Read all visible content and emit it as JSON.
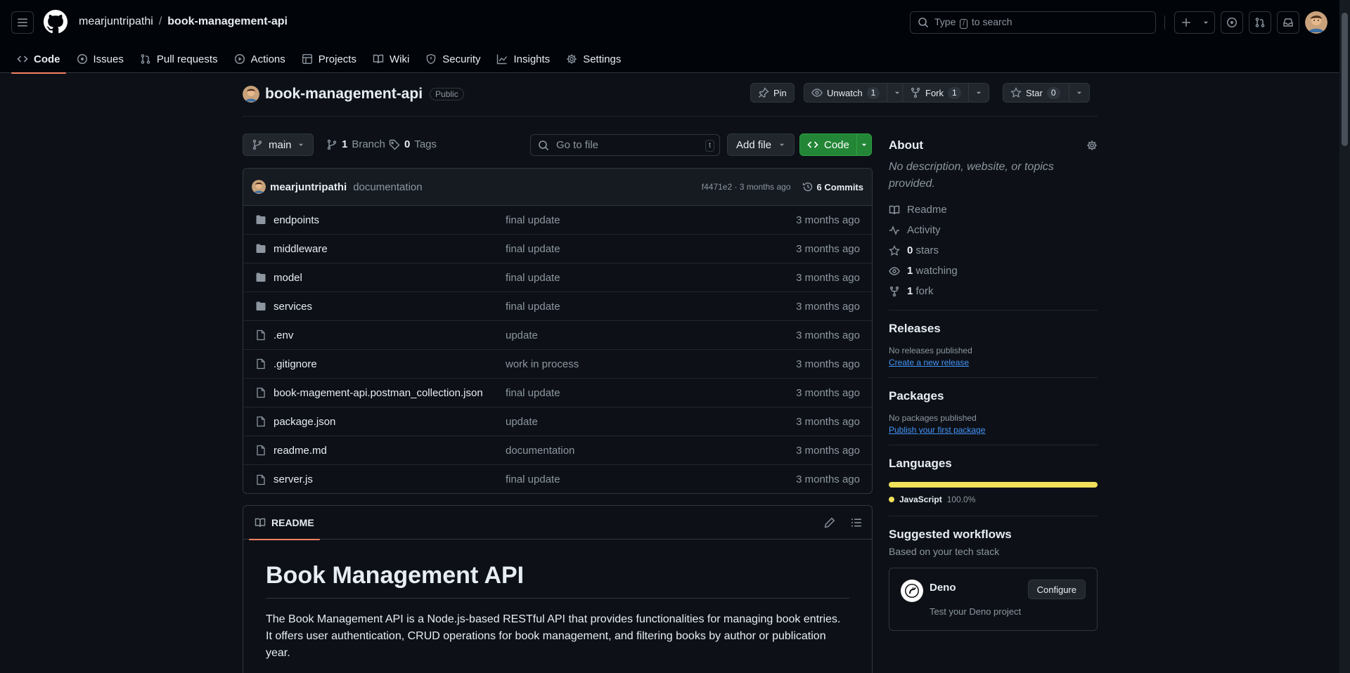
{
  "header": {
    "owner": "mearjuntripathi",
    "separator": "/",
    "repo": "book-management-api",
    "search_prefix": "Type",
    "search_key": "/",
    "search_suffix": "to search"
  },
  "nav": {
    "tabs": [
      {
        "label": "Code",
        "icon": "code-icon"
      },
      {
        "label": "Issues",
        "icon": "issue-icon"
      },
      {
        "label": "Pull requests",
        "icon": "pull-request-icon"
      },
      {
        "label": "Actions",
        "icon": "play-icon"
      },
      {
        "label": "Projects",
        "icon": "table-icon"
      },
      {
        "label": "Wiki",
        "icon": "book-icon"
      },
      {
        "label": "Security",
        "icon": "shield-icon"
      },
      {
        "label": "Insights",
        "icon": "graph-icon"
      },
      {
        "label": "Settings",
        "icon": "gear-icon"
      }
    ]
  },
  "repo": {
    "name": "book-management-api",
    "visibility": "Public",
    "pin_label": "Pin",
    "unwatch_label": "Unwatch",
    "watch_count": "1",
    "fork_label": "Fork",
    "fork_count": "1",
    "star_label": "Star",
    "star_count": "0"
  },
  "filenav": {
    "branch": "main",
    "branch_count": "1",
    "branch_label": "Branch",
    "tag_count": "0",
    "tag_label": "Tags",
    "goto_placeholder": "Go to file",
    "goto_key": "t",
    "add_file": "Add file",
    "code": "Code"
  },
  "commit": {
    "author": "mearjuntripathi",
    "message": "documentation",
    "hash_time": "f4471e2 · 3 months ago",
    "commits": "6 Commits"
  },
  "files": [
    {
      "name": "endpoints",
      "type": "folder",
      "msg": "final update",
      "age": "3 months ago"
    },
    {
      "name": "middleware",
      "type": "folder",
      "msg": "final update",
      "age": "3 months ago"
    },
    {
      "name": "model",
      "type": "folder",
      "msg": "final update",
      "age": "3 months ago"
    },
    {
      "name": "services",
      "type": "folder",
      "msg": "final update",
      "age": "3 months ago"
    },
    {
      "name": ".env",
      "type": "file",
      "msg": "update",
      "age": "3 months ago"
    },
    {
      "name": ".gitignore",
      "type": "file",
      "msg": "work in process",
      "age": "3 months ago"
    },
    {
      "name": "book-magement-api.postman_collection.json",
      "type": "file",
      "msg": "final update",
      "age": "3 months ago"
    },
    {
      "name": "package.json",
      "type": "file",
      "msg": "update",
      "age": "3 months ago"
    },
    {
      "name": "readme.md",
      "type": "file",
      "msg": "documentation",
      "age": "3 months ago"
    },
    {
      "name": "server.js",
      "type": "file",
      "msg": "final update",
      "age": "3 months ago"
    }
  ],
  "readme": {
    "tab": "README",
    "title": "Book Management API",
    "body": "The Book Management API is a Node.js-based RESTful API that provides functionalities for managing book entries. It offers user authentication, CRUD operations for book management, and filtering books by author or publication year."
  },
  "sidebar": {
    "about_title": "About",
    "about_desc": "No description, website, or topics provided.",
    "links": {
      "readme": "Readme",
      "activity": "Activity",
      "stars_count": "0",
      "stars_label": "stars",
      "watching_count": "1",
      "watching_label": "watching",
      "fork_count": "1",
      "fork_label": "fork"
    },
    "releases_title": "Releases",
    "releases_none": "No releases published",
    "releases_link": "Create a new release",
    "packages_title": "Packages",
    "packages_none": "No packages published",
    "packages_link": "Publish your first package",
    "languages_title": "Languages",
    "language": {
      "name": "JavaScript",
      "percent": "100.0%",
      "color": "#f1e05a"
    },
    "workflows_title": "Suggested workflows",
    "workflows_sub": "Based on your tech stack",
    "workflow": {
      "name": "Deno",
      "desc": "Test your Deno project",
      "button": "Configure"
    }
  },
  "colors": {
    "accent_tab": "#f78166",
    "green_button": "#238636",
    "link": "#4493f8"
  }
}
